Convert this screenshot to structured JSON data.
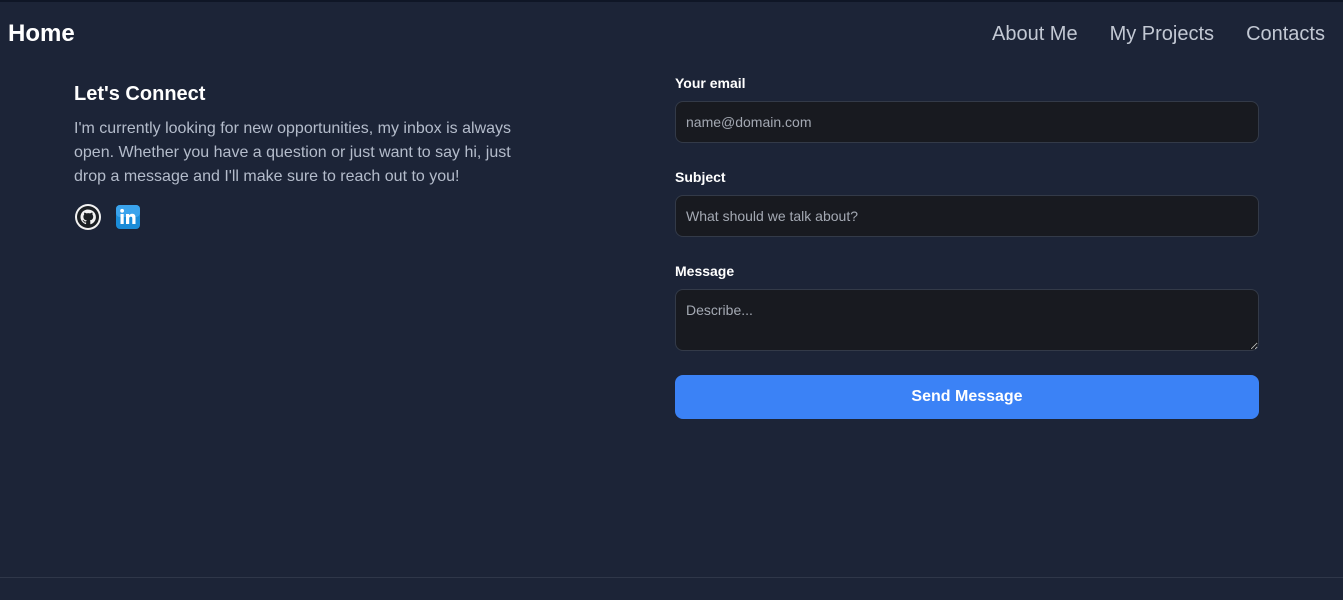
{
  "nav": {
    "home": "Home",
    "links": [
      "About Me",
      "My Projects",
      "Contacts"
    ]
  },
  "connect": {
    "title": "Let's Connect",
    "text": "I'm currently looking for new opportunities, my inbox is always open. Whether you have a question or just want to say hi, just drop a message and I'll make sure to reach out to you!",
    "socials": [
      {
        "icon": "github-icon"
      },
      {
        "icon": "linkedin-icon"
      }
    ]
  },
  "form": {
    "email_label": "Your email",
    "email_placeholder": "name@domain.com",
    "email_value": "",
    "subject_label": "Subject",
    "subject_placeholder": "What should we talk about?",
    "subject_value": "",
    "message_label": "Message",
    "message_placeholder": "Describe...",
    "message_value": "",
    "submit_label": "Send Message"
  },
  "colors": {
    "background": "#1c2437",
    "accent": "#3b82f6",
    "input_background": "#181a20"
  }
}
